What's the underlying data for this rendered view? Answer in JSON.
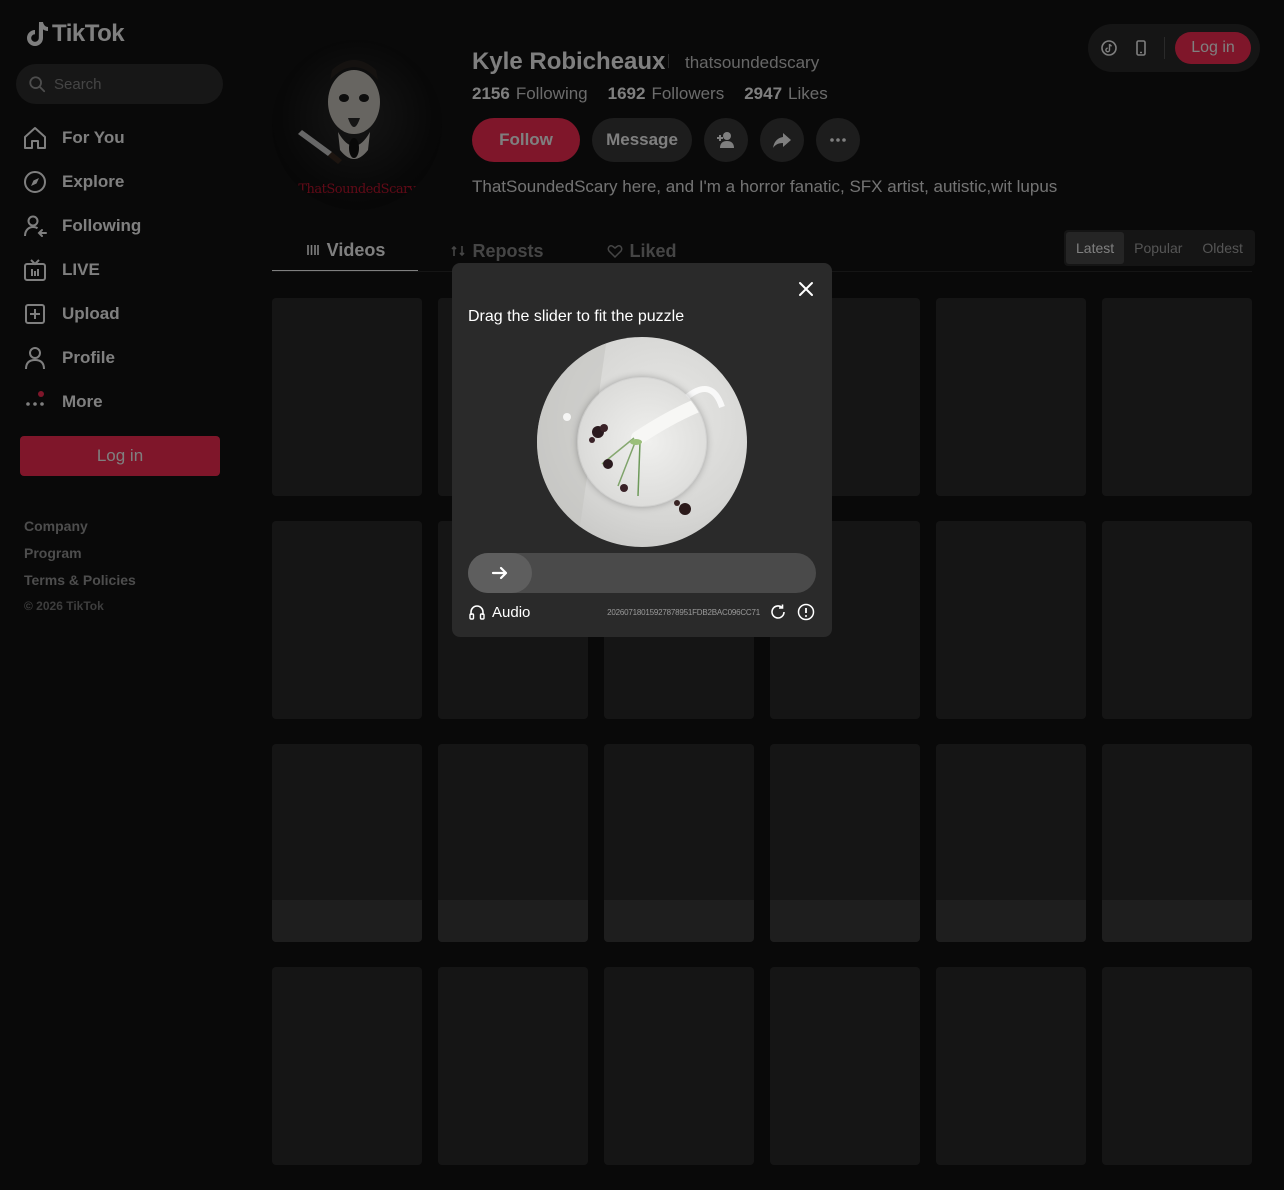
{
  "brand": {
    "name": "TikTok",
    "accent": "#fe2c55"
  },
  "search": {
    "placeholder": "Search"
  },
  "sidebar": {
    "items": [
      {
        "label": "For You",
        "icon": "home-icon"
      },
      {
        "label": "Explore",
        "icon": "compass-icon"
      },
      {
        "label": "Following",
        "icon": "following-icon"
      },
      {
        "label": "LIVE",
        "icon": "live-icon"
      },
      {
        "label": "Upload",
        "icon": "upload-icon"
      },
      {
        "label": "Profile",
        "icon": "profile-icon"
      },
      {
        "label": "More",
        "icon": "more-icon"
      }
    ],
    "login_label": "Log in",
    "footer_links": [
      "Company",
      "Program",
      "Terms & Policies"
    ],
    "copyright": "© 2026 TikTok"
  },
  "topbar": {
    "login_label": "Log in"
  },
  "profile": {
    "avatar_caption": "ThatSoundedScary",
    "name": "Kyle Robicheaux",
    "handle": "thatsoundedscary",
    "following_count": "2156",
    "following_label": "Following",
    "followers_count": "1692",
    "followers_label": "Followers",
    "likes_count": "2947",
    "likes_label": "Likes",
    "follow_label": "Follow",
    "message_label": "Message",
    "bio": "ThatSoundedScary here, and I'm a horror fanatic, SFX artist, autistic,wit lupus"
  },
  "tabs": [
    {
      "label": "Videos",
      "active": true
    },
    {
      "label": "Reposts",
      "active": false
    },
    {
      "label": "Liked",
      "active": false
    }
  ],
  "sort_options": [
    {
      "label": "Latest",
      "active": true
    },
    {
      "label": "Popular",
      "active": false
    },
    {
      "label": "Oldest",
      "active": false
    }
  ],
  "captcha": {
    "title": "Drag the slider to fit the puzzle",
    "audio_label": "Audio",
    "id": "20260718015927878951FDB2BAC096CC71"
  }
}
